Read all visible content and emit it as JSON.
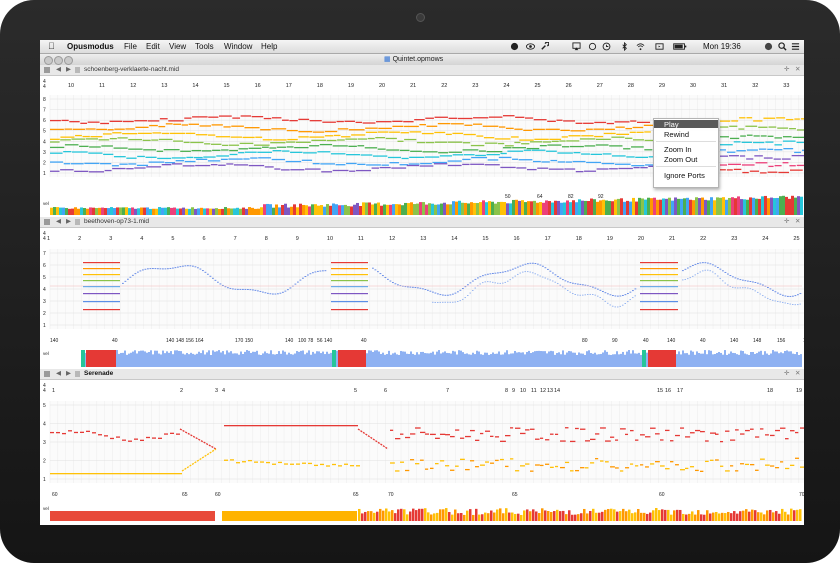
{
  "menubar": {
    "app_name": "Opusmodus",
    "menus": [
      "File",
      "Edit",
      "View",
      "Tools",
      "Window",
      "Help"
    ],
    "clock": "Mon 19:36",
    "status_icons": [
      "cloud-icon",
      "eye-icon",
      "wrench-icon",
      "airplay-icon",
      "sync-icon",
      "time-machine-icon",
      "bluetooth-icon",
      "wifi-icon",
      "battery-icon",
      "flag-icon",
      "search-icon",
      "list-icon"
    ]
  },
  "window": {
    "title": "Quintet.opmows"
  },
  "context_menu": {
    "items": [
      "Play",
      "Rewind",
      "Zoom In",
      "Zoom Out",
      "Ignore Ports"
    ],
    "highlighted": "Play"
  },
  "panes": [
    {
      "file_name": "schoenberg-verklaerte-nacht.mid",
      "bars": [
        "10",
        "11",
        "12",
        "13",
        "14",
        "15",
        "16",
        "17",
        "18",
        "19",
        "20",
        "21",
        "22",
        "23",
        "24",
        "25",
        "26",
        "27",
        "28",
        "29",
        "30",
        "31",
        "32",
        "33"
      ],
      "ticks": [
        "8",
        "7",
        "6",
        "5",
        "4",
        "3",
        "2",
        "1"
      ],
      "velocity_labels": [
        "50",
        "64",
        "82",
        "92"
      ],
      "velocity_axis": "vel",
      "colors": [
        "#e53935",
        "#ff9800",
        "#ffc107",
        "#8bc34a",
        "#4caf50",
        "#26c6da",
        "#42a5f5",
        "#7e57c2",
        "#ec407a"
      ]
    },
    {
      "file_name": "beethoven-op73-1.mid",
      "bars": [
        "1",
        "2",
        "3",
        "4",
        "5",
        "6",
        "7",
        "8",
        "9",
        "10",
        "11",
        "12",
        "13",
        "14",
        "15",
        "16",
        "17",
        "18",
        "19",
        "20",
        "21",
        "22",
        "23",
        "24",
        "25"
      ],
      "ticks": [
        "7",
        "6",
        "5",
        "4",
        "3",
        "2",
        "1"
      ],
      "velocity_labels": [
        "140",
        "40",
        "140 148 156 164",
        "170 150",
        "140",
        "100 78",
        "56",
        "140",
        "40",
        "80",
        "90",
        "40",
        "140",
        "40",
        "140",
        "148",
        "156",
        "118 174",
        "72",
        "71"
      ],
      "velocity_axis": "vel",
      "colors": [
        "#e53935",
        "#ff9800",
        "#ffc107",
        "#8bc34a",
        "#42a5f5",
        "#7e57c2",
        "#5c8fe6"
      ]
    },
    {
      "file_name": "Serenade",
      "bars": [
        "1",
        "2",
        "3",
        "4",
        "5",
        "6",
        "7",
        "8",
        "9",
        "10",
        "11",
        "12",
        "13",
        "14",
        "15",
        "16",
        "17",
        "18",
        "19"
      ],
      "ticks": [
        "5",
        "4",
        "3",
        "2",
        "1"
      ],
      "velocity_labels": [
        "60",
        "65",
        "60",
        "65",
        "70",
        "65",
        "60",
        "70"
      ],
      "velocity_axis": "vel",
      "colors": [
        "#e53935",
        "#ffc107",
        "#ff9800"
      ]
    }
  ]
}
